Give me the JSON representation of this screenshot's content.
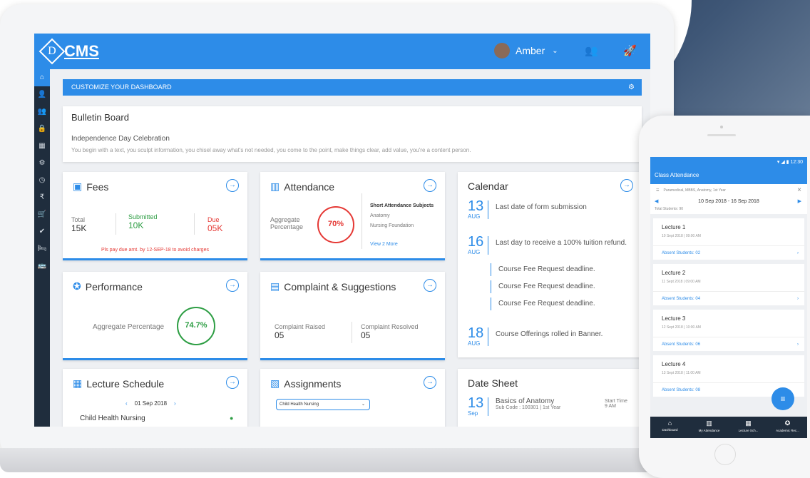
{
  "app": {
    "logo_letter": "D",
    "logo_text": "CMS"
  },
  "topbar": {
    "user_name": "Amber"
  },
  "customize": {
    "label": "CUSTOMIZE YOUR DASHBOARD"
  },
  "bulletin": {
    "title": "Bulletin Board",
    "subtitle": "Independence Day Celebration",
    "text": "You begin with a text, you sculpt information, you chisel away what's not needed, you come to the point, make things clear, add value, you're a content person."
  },
  "fees": {
    "title": "Fees",
    "total_label": "Total",
    "total_value": "15K",
    "submitted_label": "Submitted",
    "submitted_value": "10K",
    "due_label": "Due",
    "due_value": "05K",
    "note": "Pls pay due amt. by 12-SEP-18 to avoid charges"
  },
  "attendance": {
    "title": "Attendance",
    "aggregate_label": "Aggregate Percentage",
    "percent_text": "70%",
    "percent": 70,
    "short_title": "Short Attendance Subjects",
    "subjects": [
      "Anatomy",
      "Nursing Foundation"
    ],
    "view_more": "View 2 More"
  },
  "performance": {
    "title": "Performance",
    "aggregate_label": "Aggregate Percentage",
    "percent_text": "74.7%",
    "percent": 74.7
  },
  "complaint": {
    "title": "Complaint & Suggestions",
    "raised_label": "Complaint Raised",
    "raised_value": "05",
    "resolved_label": "Complaint Resolved",
    "resolved_value": "05"
  },
  "calendar": {
    "title": "Calendar",
    "events": [
      {
        "day": "13",
        "month": "AUG",
        "text": "Last date of form submission"
      },
      {
        "day": "16",
        "month": "AUG",
        "text": "Last day to receive a 100% tuition refund."
      },
      {
        "day": "18",
        "month": "AUG",
        "text": "Course Offerings rolled in Banner."
      }
    ],
    "sub_events": [
      "Course Fee Request deadline.",
      "Course Fee Request deadline.",
      "Course Fee Request deadline."
    ]
  },
  "lecture_schedule": {
    "title": "Lecture Schedule",
    "date": "01 Sep 2018",
    "subject": "Child Health Nursing"
  },
  "assignments": {
    "title": "Assignments",
    "selected": "Child Health Nursing"
  },
  "date_sheet": {
    "title": "Date Sheet",
    "day": "13",
    "month": "Sep",
    "subject": "Basics of Anatomy",
    "sub_code": "Sub Code : 100301 | 1st Year",
    "start_label": "Start Time",
    "start_value": "9 AM"
  },
  "phone": {
    "time": "12:30",
    "title": "Class Attendance",
    "filter": "Paramedical, MBBS, Anatomy, 1st Year",
    "week": "10 Sep 2018 - 16 Sep 2018",
    "total": "Total Students: 90",
    "lectures": [
      {
        "name": "Lecture 1",
        "datetime": "10 Sept 2018 | 09:00 AM",
        "absent": "Absent Students: 02"
      },
      {
        "name": "Lecture 2",
        "datetime": "11 Sept 2018 | 09:00 AM",
        "absent": "Absent Students: 04"
      },
      {
        "name": "Lecture 3",
        "datetime": "12 Sept 2018 | 10:00 AM",
        "absent": "Absent Students: 06"
      },
      {
        "name": "Lecture 4",
        "datetime": "13 Sept 2018 | 11:00 AM",
        "absent": "Absent Students: 08"
      }
    ],
    "nav": [
      "Dashboard",
      "My Attendance",
      "Lecture Sch...",
      "Academic Rec..."
    ]
  },
  "colors": {
    "accent": "#2d8ce8",
    "sidebar": "#1f2d3d",
    "danger": "#e53935",
    "success": "#2e9e44"
  },
  "icons": {
    "sidebar": [
      "home-icon",
      "user-icon",
      "group-icon",
      "lock-icon",
      "calendar-icon",
      "settings-icon",
      "clock-icon",
      "rupee-icon",
      "cart-icon",
      "check-icon",
      "bed-icon",
      "bus-icon"
    ]
  }
}
